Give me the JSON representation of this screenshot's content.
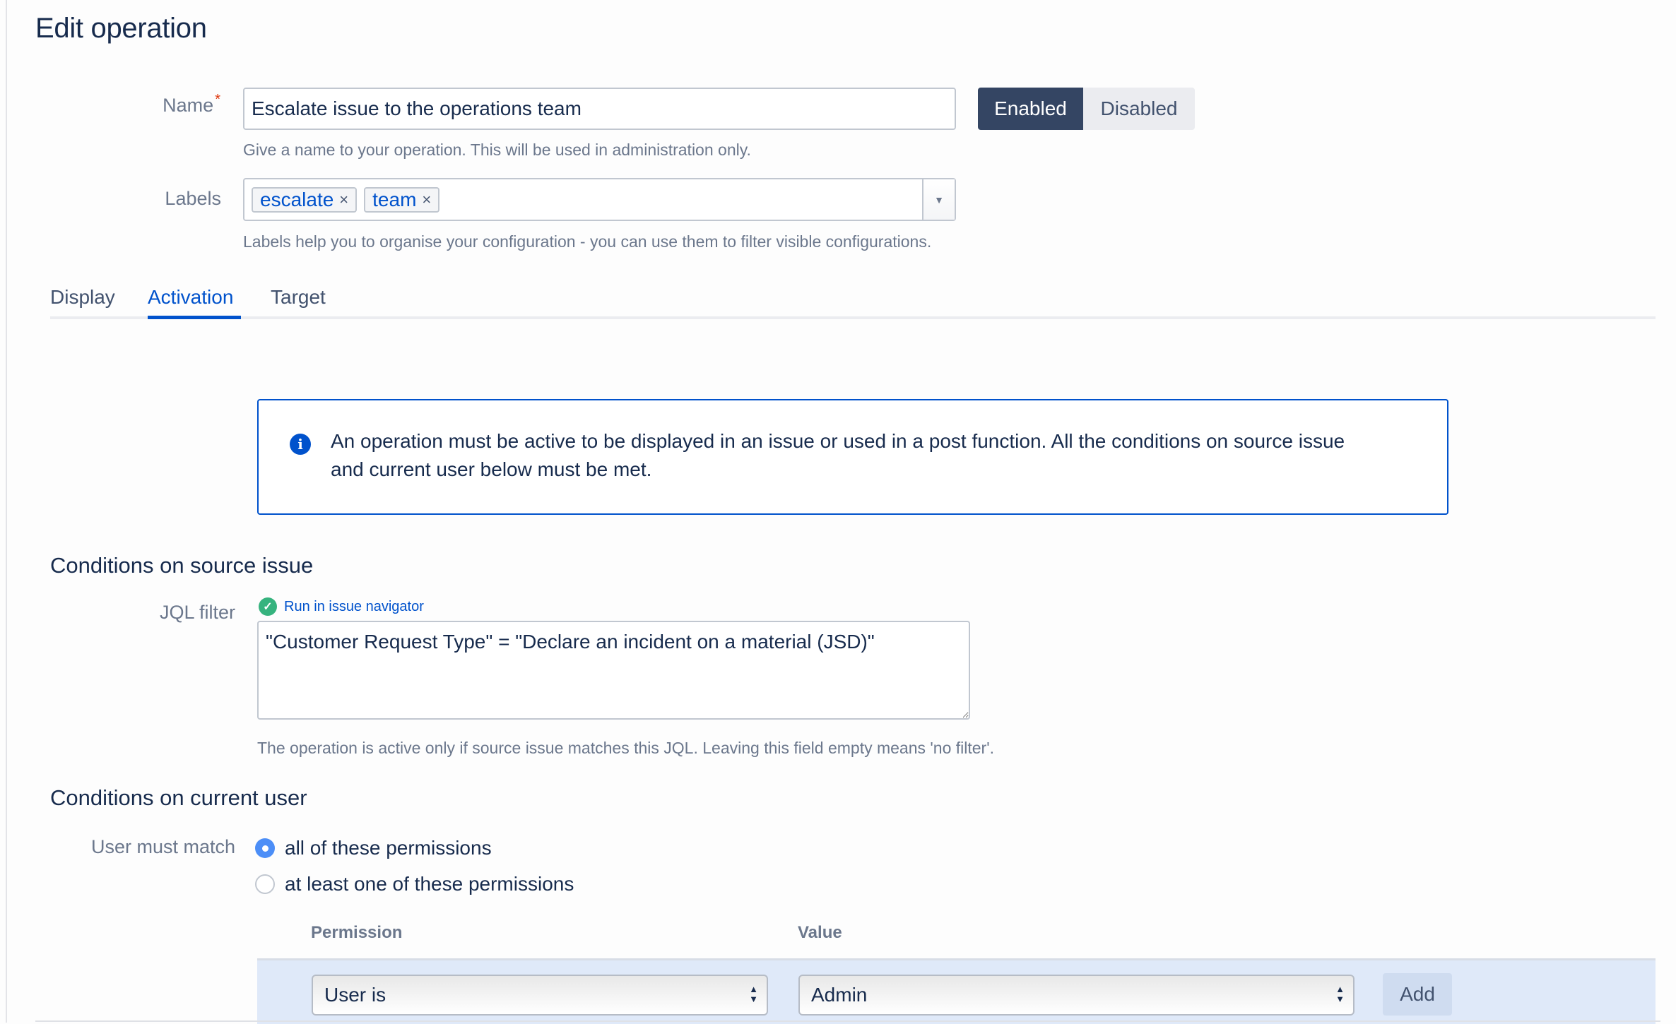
{
  "page_title": "Edit operation",
  "name_field": {
    "label": "Name",
    "required_marker": "*",
    "value": "Escalate issue to the operations team",
    "help": "Give a name to your operation. This will be used in administration only."
  },
  "status_toggle": {
    "enabled_label": "Enabled",
    "disabled_label": "Disabled",
    "selected": "Enabled",
    "active_color": "#344563"
  },
  "labels_field": {
    "label": "Labels",
    "tags": [
      {
        "text": "escalate",
        "remove": "×"
      },
      {
        "text": "team",
        "remove": "×"
      }
    ],
    "dropdown_icon": "▼",
    "help": "Labels help you to organise your configuration - you can use them to filter visible configurations."
  },
  "tabs": [
    {
      "label": "Display",
      "active": false
    },
    {
      "label": "Activation",
      "active": true
    },
    {
      "label": "Target",
      "active": false
    }
  ],
  "info_message": {
    "icon": "info-icon",
    "icon_glyph": "i",
    "text": "An operation must be active to be displayed in an issue or used in a post function. All the conditions on source issue and current user below must be met."
  },
  "source_issue": {
    "heading": "Conditions on source issue",
    "jql_label": "JQL filter",
    "valid_icon": "✓",
    "run_link": "Run in issue navigator",
    "jql_value": "\"Customer Request Type\" = \"Declare an incident on a material (JSD)\"",
    "help": "The operation is active only if source issue matches this JQL. Leaving this field empty means 'no filter'."
  },
  "current_user": {
    "heading": "Conditions on current user",
    "match_label": "User must match",
    "options": [
      {
        "label": "all of these permissions",
        "selected": true
      },
      {
        "label": "at least one of these permissions",
        "selected": false
      }
    ],
    "table": {
      "columns": [
        "Permission",
        "Value"
      ],
      "new_row": {
        "permission": "User is",
        "value": "Admin",
        "add_label": "Add"
      }
    }
  },
  "colors": {
    "brand_blue": "#0052cc",
    "success_green": "#36b37e",
    "row_highlight": "#dfe9f9"
  }
}
